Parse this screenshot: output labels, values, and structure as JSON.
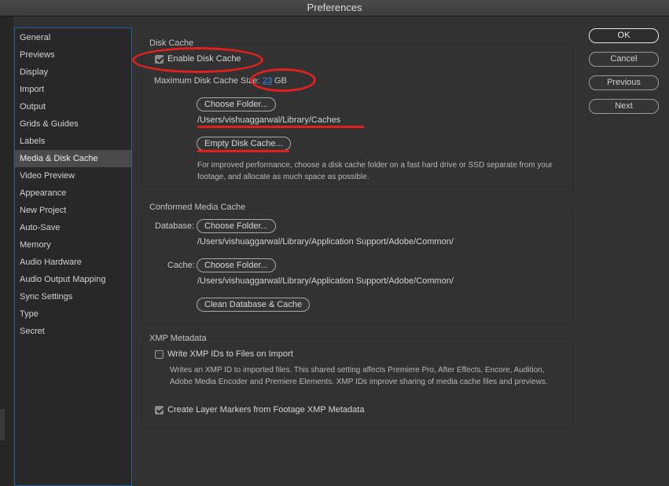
{
  "window": {
    "title": "Preferences"
  },
  "sidebar": {
    "items": [
      {
        "label": "General"
      },
      {
        "label": "Previews"
      },
      {
        "label": "Display"
      },
      {
        "label": "Import"
      },
      {
        "label": "Output"
      },
      {
        "label": "Grids & Guides"
      },
      {
        "label": "Labels"
      },
      {
        "label": "Media & Disk Cache",
        "selected": true
      },
      {
        "label": "Video Preview"
      },
      {
        "label": "Appearance"
      },
      {
        "label": "New Project"
      },
      {
        "label": "Auto-Save"
      },
      {
        "label": "Memory"
      },
      {
        "label": "Audio Hardware"
      },
      {
        "label": "Audio Output Mapping"
      },
      {
        "label": "Sync Settings"
      },
      {
        "label": "Type"
      },
      {
        "label": "Secret"
      }
    ]
  },
  "disk_cache": {
    "title": "Disk Cache",
    "enable_label": "Enable Disk Cache",
    "enabled": true,
    "max_size_label": "Maximum Disk Cache Size:",
    "max_size_value": "23",
    "max_size_unit": "GB",
    "choose_folder_label": "Choose Folder...",
    "path": "/Users/vishuaggarwal/Library/Caches",
    "empty_label": "Empty Disk Cache...",
    "description": "For improved performance, choose a disk cache folder on a fast hard drive or SSD separate from your footage, and allocate as much space as possible."
  },
  "conformed_cache": {
    "title": "Conformed Media Cache",
    "database_label": "Database:",
    "database_button": "Choose Folder...",
    "database_path": "/Users/vishuaggarwal/Library/Application Support/Adobe/Common/",
    "cache_label": "Cache:",
    "cache_button": "Choose Folder...",
    "cache_path": "/Users/vishuaggarwal/Library/Application Support/Adobe/Common/",
    "clean_label": "Clean Database & Cache"
  },
  "xmp": {
    "title": "XMP Metadata",
    "write_label": "Write XMP IDs to Files on Import",
    "write_checked": false,
    "write_description": "Writes an XMP ID to imported files. This shared setting affects Premiere Pro, After Effects, Encore, Audition, Adobe Media Encoder and Premiere Elements. XMP IDs improve sharing of media cache files and previews.",
    "markers_label": "Create Layer Markers from Footage XMP Metadata",
    "markers_checked": true
  },
  "actions": {
    "ok": "OK",
    "cancel": "Cancel",
    "previous": "Previous",
    "next": "Next"
  },
  "colors": {
    "annotation_red": "#e2201d",
    "accent_blue": "#3c8cff",
    "selection_border": "#1f5fa8"
  }
}
